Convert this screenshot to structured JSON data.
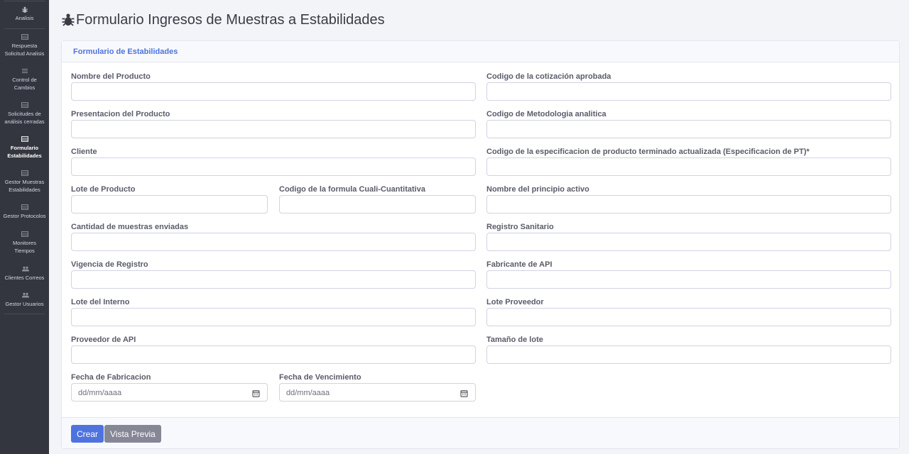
{
  "sidebar": {
    "items": [
      {
        "label": "Analisis",
        "icon": "bug-icon"
      },
      {
        "label": "Respuesta Solicitud Analisis",
        "icon": "table-icon"
      },
      {
        "label": "Control de Cambios",
        "icon": "list-icon"
      },
      {
        "label": "Solicitudes de análisis cerradas",
        "icon": "table-icon"
      },
      {
        "label": "Formulario Estabilidades",
        "icon": "table-icon",
        "active": true
      },
      {
        "label": "Gestor Muestras Estabilidades",
        "icon": "table-icon"
      },
      {
        "label": "Gestor Protocolos",
        "icon": "table-icon"
      },
      {
        "label": "Monitores Tiempos",
        "icon": "table-icon"
      },
      {
        "label": "Clientes Correos",
        "icon": "users-icon"
      },
      {
        "label": "Gestor Usuarios",
        "icon": "users-icon"
      }
    ]
  },
  "page": {
    "title": "Formulario Ingresos de Muestras a Estabilidades",
    "title_icon": "bug-icon"
  },
  "card": {
    "header": "Formulario de Estabilidades"
  },
  "form": {
    "nombre_producto": {
      "label": "Nombre del Producto",
      "value": ""
    },
    "presentacion_producto": {
      "label": "Presentacion del Producto",
      "value": ""
    },
    "cliente": {
      "label": "Cliente",
      "value": ""
    },
    "lote_producto": {
      "label": "Lote de Producto",
      "value": ""
    },
    "codigo_formula": {
      "label": "Codigo de la formula Cuali-Cuantitativa",
      "value": ""
    },
    "cantidad_muestras": {
      "label": "Cantidad de muestras enviadas",
      "value": ""
    },
    "vigencia_registro": {
      "label": "Vigencia de Registro",
      "value": ""
    },
    "lote_interno": {
      "label": "Lote del Interno",
      "value": ""
    },
    "proveedor_api": {
      "label": "Proveedor de API",
      "value": ""
    },
    "fecha_fabricacion": {
      "label": "Fecha de Fabricacion",
      "value": "dd/mm/aaaa"
    },
    "fecha_vencimiento": {
      "label": "Fecha de Vencimiento",
      "value": "dd/mm/aaaa"
    },
    "codigo_cotizacion": {
      "label": "Codigo de la cotización aprobada",
      "value": ""
    },
    "codigo_metodologia": {
      "label": "Codigo de Metodologia analitica",
      "value": ""
    },
    "codigo_especificacion": {
      "label": "Codigo de la especificacion de producto terminado actualizada (Especificacion de PT)*",
      "value": ""
    },
    "principio_activo": {
      "label": "Nombre del principio activo",
      "value": ""
    },
    "registro_sanitario": {
      "label": "Registro Sanitario",
      "value": ""
    },
    "fabricante_api": {
      "label": "Fabricante de API",
      "value": ""
    },
    "lote_proveedor": {
      "label": "Lote Proveedor",
      "value": ""
    },
    "tamano_lote": {
      "label": "Tamaño de lote",
      "value": ""
    }
  },
  "actions": {
    "crear": "Crear",
    "vista_previa": "Vista Previa"
  },
  "colors": {
    "sidebar_bg": "#34363f",
    "accent": "#4e73df",
    "secondary": "#858796"
  }
}
